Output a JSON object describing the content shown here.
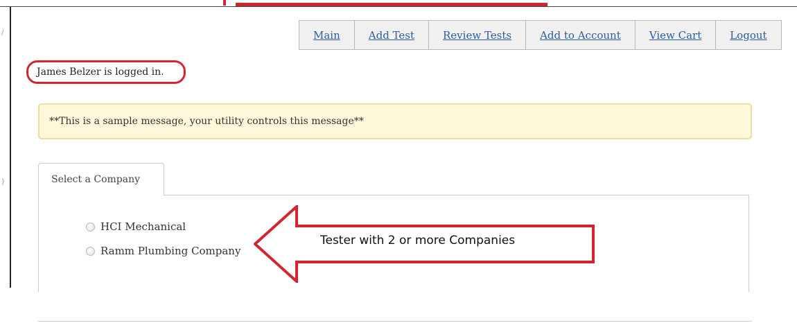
{
  "nav": {
    "items": [
      "Main",
      "Add Test",
      "Review Tests",
      "Add to Account",
      "View Cart",
      "Logout"
    ]
  },
  "status": {
    "logged_in_text": "James Belzer is logged in."
  },
  "alert": {
    "message": "**This is a sample message, your utility controls this message**"
  },
  "company_selector": {
    "tab_label": "Select a Company",
    "options": [
      "HCI Mechanical",
      "Ramm Plumbing Company"
    ]
  },
  "annotation": {
    "callout_text": "Tester with 2 or more Companies"
  },
  "colors": {
    "annotation_red": "#d0262e",
    "link_blue": "#2d5c9a",
    "alert_bg": "#fcf8d9"
  }
}
